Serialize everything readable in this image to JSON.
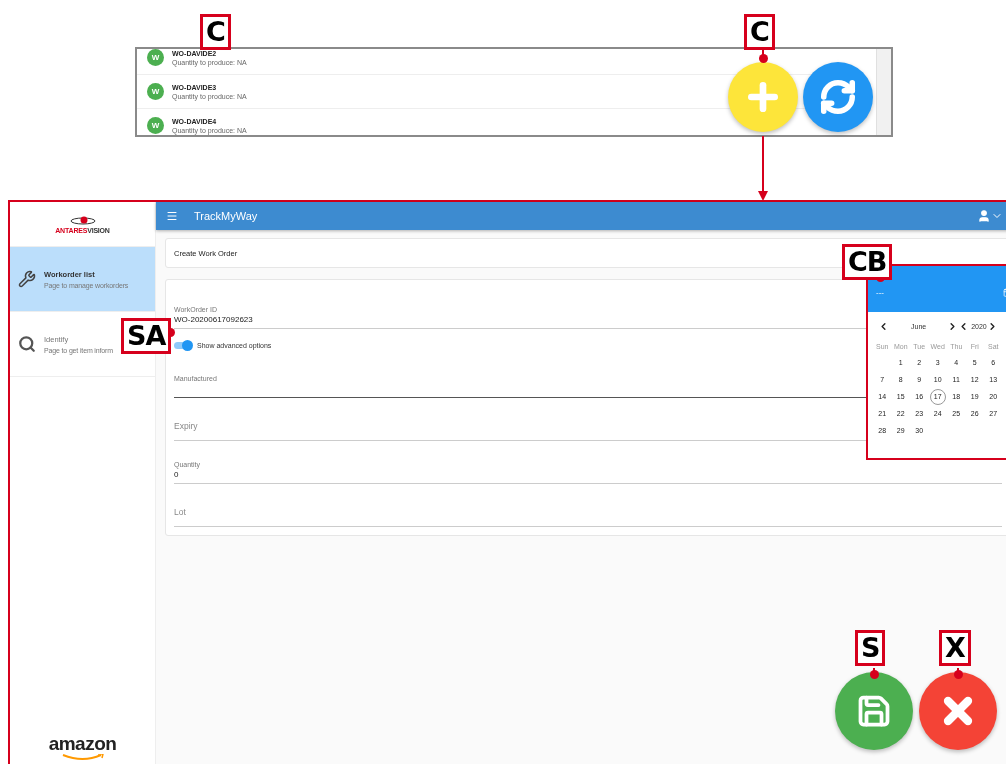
{
  "top_list": {
    "items": [
      {
        "avatar": "W",
        "title": "WO-DAVIDE2",
        "subtitle": "Quantity to produce: NA"
      },
      {
        "avatar": "W",
        "title": "WO-DAVIDE3",
        "subtitle": "Quantity to produce: NA"
      },
      {
        "avatar": "W",
        "title": "WO-DAVIDE4",
        "subtitle": "Quantity to produce: NA"
      }
    ]
  },
  "callouts": [
    {
      "label": "C"
    },
    {
      "label": "C"
    },
    {
      "label": "SA"
    },
    {
      "label": "CB"
    },
    {
      "label": "S"
    },
    {
      "label": "X"
    }
  ],
  "app": {
    "logo_text": [
      "ANTARES",
      "VISION"
    ],
    "sidebar": {
      "items": [
        {
          "title": "Workorder list",
          "subtitle": "Page to manage workorders",
          "kind": "tools",
          "selected": true
        },
        {
          "title": "Identify",
          "subtitle": "Page to get item inform",
          "kind": "search",
          "selected": false
        }
      ]
    },
    "footer_logo": "amazon",
    "app_bar": {
      "title": "TrackMyWay"
    },
    "page_title": "Create Work Order",
    "form": {
      "fields": [
        {
          "kind": "field",
          "label": "WorkOrder ID",
          "value": "WO-20200617092623",
          "focused": false
        },
        {
          "kind": "toggle",
          "label": "Show advanced options",
          "on": true
        },
        {
          "kind": "field",
          "label": "Manufactured",
          "focused": true
        },
        {
          "kind": "field",
          "label": "Expiry",
          "focused": false
        },
        {
          "kind": "field",
          "label": "Quantity",
          "value": "0",
          "focused": false
        },
        {
          "kind": "field",
          "label": "Lot",
          "focused": false
        }
      ]
    },
    "calendar": {
      "header": "---",
      "month": "June",
      "year": "2020",
      "weekdays": [
        "Sun",
        "Mon",
        "Tue",
        "Wed",
        "Thu",
        "Fri",
        "Sat"
      ],
      "weeks": [
        [
          {
            "kind": "empty"
          },
          {
            "kind": "day",
            "day": "1",
            "today": false
          },
          {
            "kind": "day",
            "day": "2",
            "today": false
          },
          {
            "kind": "day",
            "day": "3",
            "today": false
          },
          {
            "kind": "day",
            "day": "4",
            "today": false
          },
          {
            "kind": "day",
            "day": "5",
            "today": false
          },
          {
            "kind": "day",
            "day": "6",
            "today": false
          }
        ],
        [
          {
            "kind": "day",
            "day": "7",
            "today": false
          },
          {
            "kind": "day",
            "day": "8",
            "today": false
          },
          {
            "kind": "day",
            "day": "9",
            "today": false
          },
          {
            "kind": "day",
            "day": "10",
            "today": false
          },
          {
            "kind": "day",
            "day": "11",
            "today": false
          },
          {
            "kind": "day",
            "day": "12",
            "today": false
          },
          {
            "kind": "day",
            "day": "13",
            "today": false
          }
        ],
        [
          {
            "kind": "day",
            "day": "14",
            "today": false
          },
          {
            "kind": "day",
            "day": "15",
            "today": false
          },
          {
            "kind": "day",
            "day": "16",
            "today": false
          },
          {
            "kind": "day",
            "day": "17",
            "today": true
          },
          {
            "kind": "day",
            "day": "18",
            "today": false
          },
          {
            "kind": "day",
            "day": "19",
            "today": false
          },
          {
            "kind": "day",
            "day": "20",
            "today": false
          }
        ],
        [
          {
            "kind": "day",
            "day": "21",
            "today": false
          },
          {
            "kind": "day",
            "day": "22",
            "today": false
          },
          {
            "kind": "day",
            "day": "23",
            "today": false
          },
          {
            "kind": "day",
            "day": "24",
            "today": false
          },
          {
            "kind": "day",
            "day": "25",
            "today": false
          },
          {
            "kind": "day",
            "day": "26",
            "today": false
          },
          {
            "kind": "day",
            "day": "27",
            "today": false
          }
        ],
        [
          {
            "kind": "day",
            "day": "28",
            "today": false
          },
          {
            "kind": "day",
            "day": "29",
            "today": false
          },
          {
            "kind": "day",
            "day": "30",
            "today": false
          }
        ]
      ]
    }
  }
}
